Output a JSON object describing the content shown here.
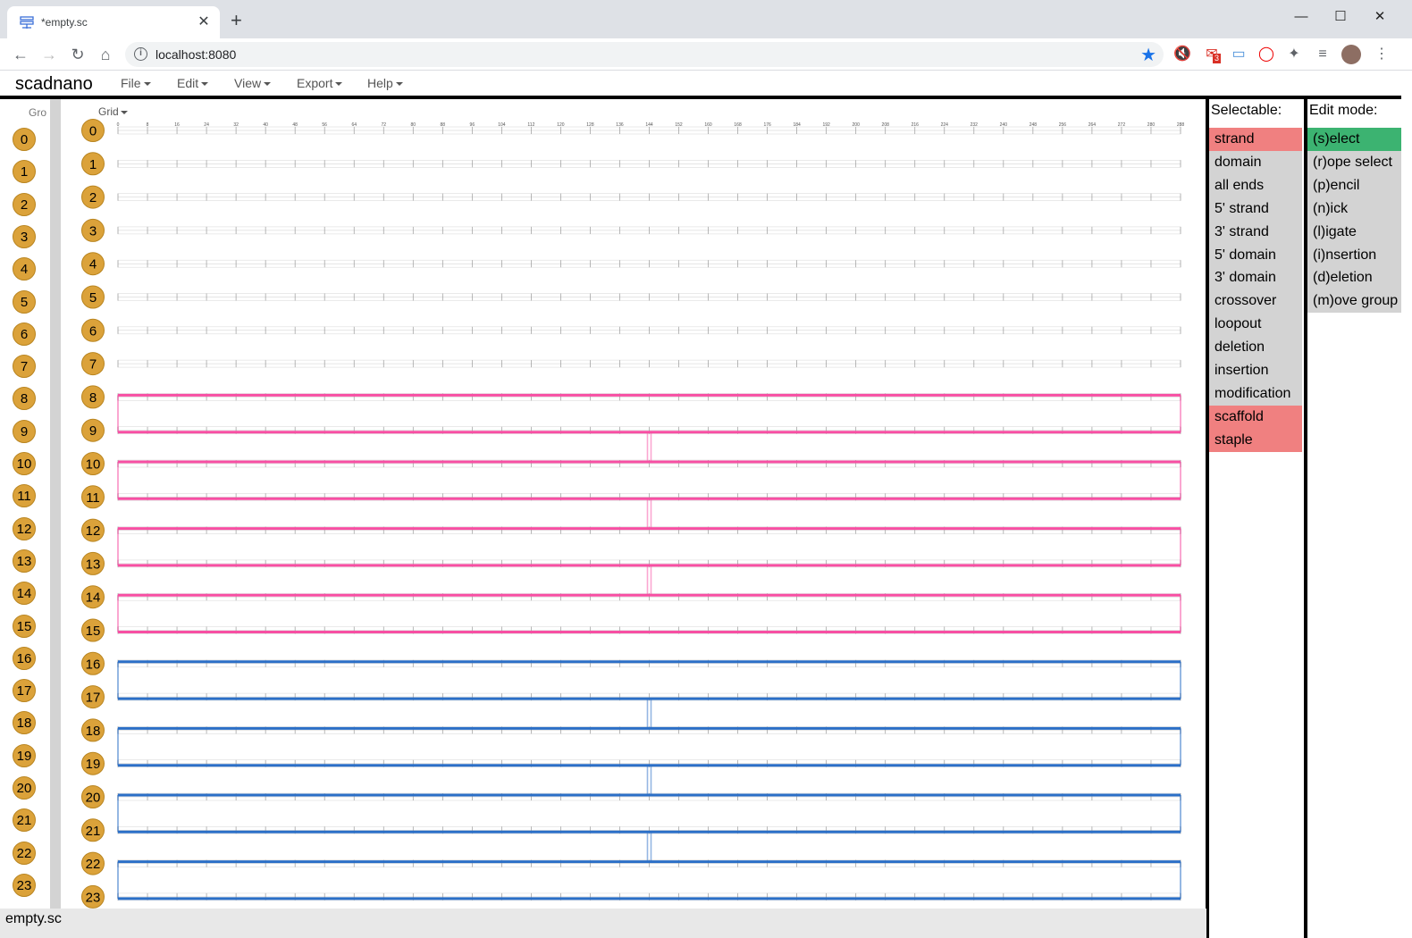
{
  "browser": {
    "tab_title": "*empty.sc",
    "url": "localhost:8080",
    "mail_badge": "3"
  },
  "app": {
    "title": "scadnano",
    "menus": [
      "File",
      "Edit",
      "View",
      "Export",
      "Help"
    ]
  },
  "side_view": {
    "header": "Gro",
    "helix_labels": [
      "0",
      "1",
      "2",
      "3",
      "4",
      "5",
      "6",
      "7",
      "8",
      "9",
      "10",
      "11",
      "12",
      "13",
      "14",
      "15",
      "16",
      "17",
      "18",
      "19",
      "20",
      "21",
      "22",
      "23"
    ]
  },
  "main_view": {
    "header": "Grid",
    "helix_labels": [
      "0",
      "1",
      "2",
      "3",
      "4",
      "5",
      "6",
      "7",
      "8",
      "9",
      "10",
      "11",
      "12",
      "13",
      "14",
      "15",
      "16",
      "17",
      "18",
      "19",
      "20",
      "21",
      "22",
      "23"
    ],
    "tick_labels": [
      "0",
      "8",
      "16",
      "24",
      "32",
      "40",
      "48",
      "56",
      "64",
      "72",
      "80",
      "88",
      "96",
      "104",
      "112",
      "120",
      "128",
      "136",
      "144",
      "152",
      "160",
      "168",
      "176",
      "184",
      "192",
      "200",
      "208",
      "216",
      "224",
      "232",
      "240",
      "248",
      "256",
      "264",
      "272",
      "280",
      "288"
    ],
    "scaffold_color": "#f74fa3",
    "staple_color": "#2b6fc7"
  },
  "selectable": {
    "title": "Selectable:",
    "items": [
      {
        "label": "strand",
        "active": true
      },
      {
        "label": "domain",
        "active": false
      },
      {
        "label": "all ends",
        "active": false
      },
      {
        "label": "5' strand",
        "active": false
      },
      {
        "label": "3' strand",
        "active": false
      },
      {
        "label": "5' domain",
        "active": false
      },
      {
        "label": "3' domain",
        "active": false
      },
      {
        "label": "crossover",
        "active": false
      },
      {
        "label": "loopout",
        "active": false
      },
      {
        "label": "deletion",
        "active": false
      },
      {
        "label": "insertion",
        "active": false
      },
      {
        "label": "modification",
        "active": false
      },
      {
        "label": "scaffold",
        "active": true
      },
      {
        "label": "staple",
        "active": true
      }
    ],
    "active_color": "#f08080",
    "inactive_color": "#d3d3d3"
  },
  "edit_mode": {
    "title": "Edit mode:",
    "items": [
      {
        "label": "(s)elect",
        "active": true
      },
      {
        "label": "(r)ope select",
        "active": false
      },
      {
        "label": "(p)encil",
        "active": false
      },
      {
        "label": "(n)ick",
        "active": false
      },
      {
        "label": "(l)igate",
        "active": false
      },
      {
        "label": "(i)nsertion",
        "active": false
      },
      {
        "label": "(d)eletion",
        "active": false
      },
      {
        "label": "(m)ove group",
        "active": false
      }
    ],
    "active_color": "#3cb371"
  },
  "status": {
    "filename": "empty.sc"
  }
}
